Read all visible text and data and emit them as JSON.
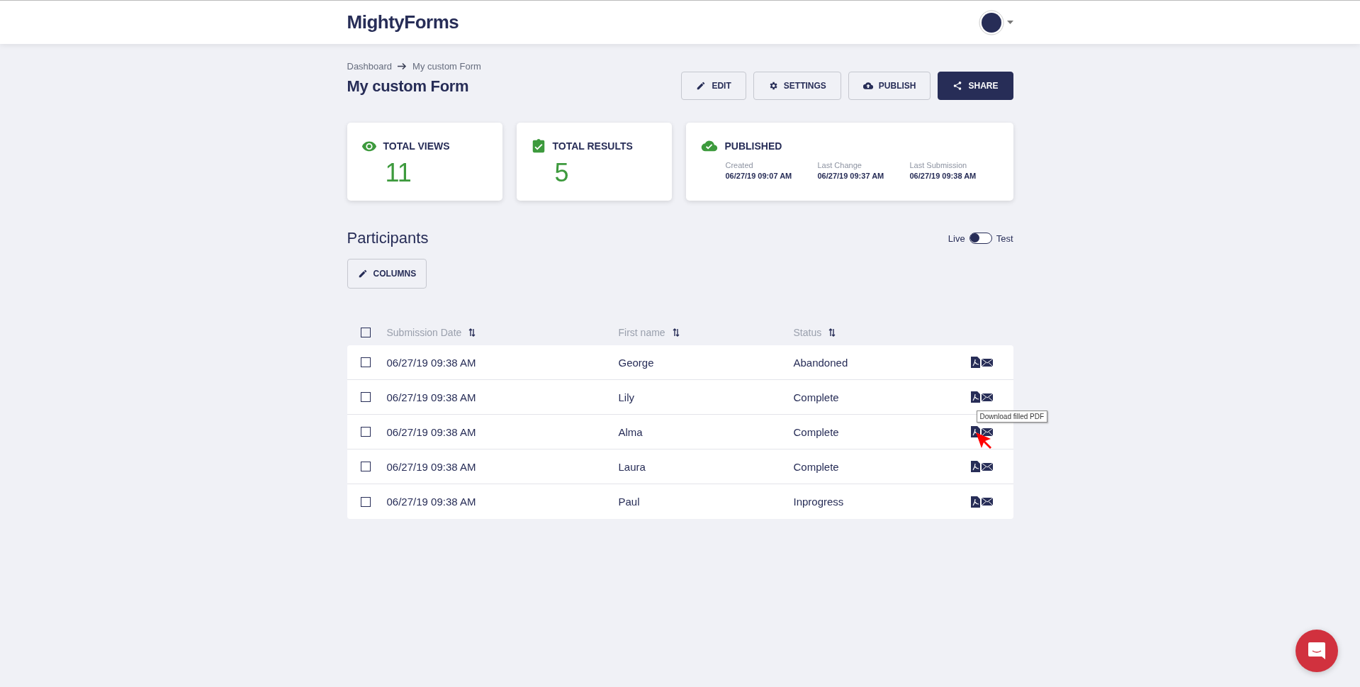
{
  "header": {
    "logo": "MightyForms"
  },
  "breadcrumb": [
    "Dashboard",
    "My custom Form"
  ],
  "title": "My custom Form",
  "actions": [
    {
      "kind": "edit",
      "label": "EDIT",
      "primary": false
    },
    {
      "kind": "settings",
      "label": "SETTINGS",
      "primary": false
    },
    {
      "kind": "publish",
      "label": "PUBLISH",
      "primary": false
    },
    {
      "kind": "share",
      "label": "SHARE",
      "primary": true
    }
  ],
  "stats": [
    {
      "kind": "views",
      "label": "TOTAL VIEWS",
      "value": "11"
    },
    {
      "kind": "results",
      "label": "TOTAL RESULTS",
      "value": "5"
    },
    {
      "kind": "published",
      "label": "PUBLISHED",
      "dates": [
        {
          "label": "Created",
          "value": "06/27/19 09:07 AM"
        },
        {
          "label": "Last Change",
          "value": "06/27/19 09:37 AM"
        },
        {
          "label": "Last Submission",
          "value": "06/27/19 09:38 AM"
        }
      ]
    }
  ],
  "participants": {
    "title": "Participants",
    "mode_toggle": {
      "left_label": "Live",
      "right_label": "Test",
      "on": false
    },
    "columns_button": "COLUMNS"
  },
  "table": {
    "select_all_checked": false,
    "columns": [
      "Submission Date",
      "First name",
      "Status"
    ],
    "rows": [
      {
        "checked": false,
        "cells": [
          "06/27/19 09:38 AM",
          "George",
          "Abandoned"
        ]
      },
      {
        "checked": false,
        "cells": [
          "06/27/19 09:38 AM",
          "Lily",
          "Complete"
        ]
      },
      {
        "checked": false,
        "cells": [
          "06/27/19 09:38 AM",
          "Alma",
          "Complete"
        ],
        "tooltip": "Download filled PDF"
      },
      {
        "checked": false,
        "cells": [
          "06/27/19 09:38 AM",
          "Laura",
          "Complete"
        ]
      },
      {
        "checked": false,
        "cells": [
          "06/27/19 09:38 AM",
          "Paul",
          "Inprogress"
        ]
      }
    ]
  }
}
